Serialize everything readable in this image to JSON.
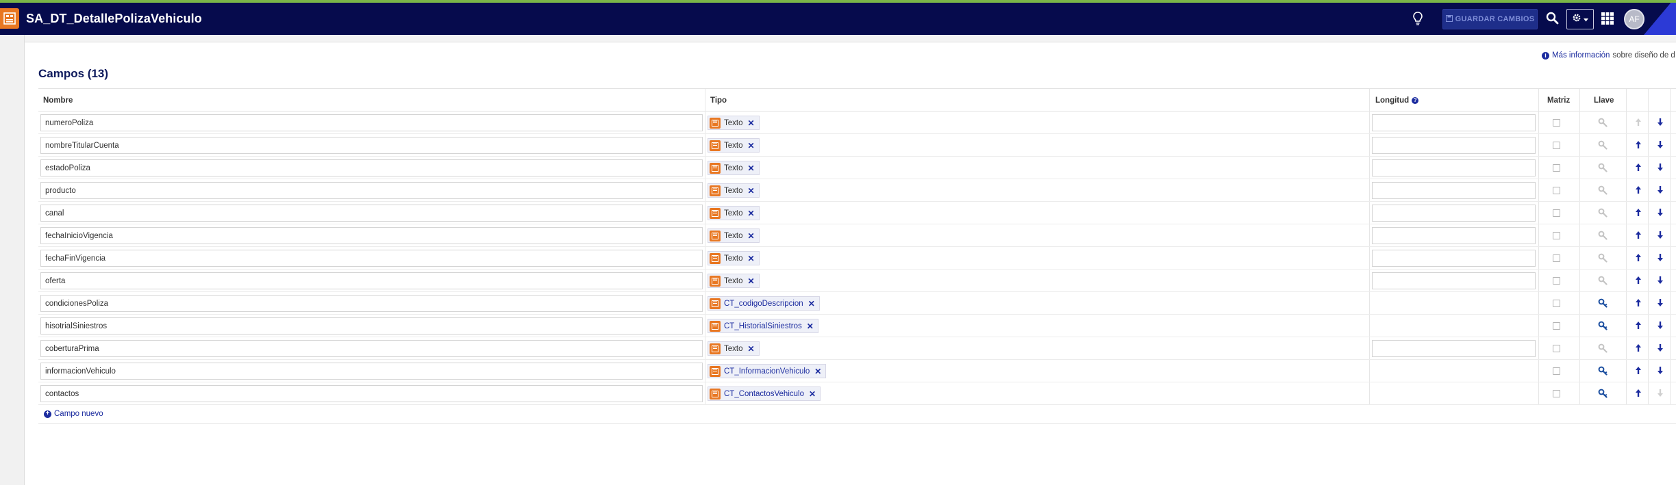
{
  "header": {
    "title": "SA_DT_DetallePolizaVehiculo",
    "save_label": "GUARDAR CAMBIOS",
    "avatar_initials": "AF",
    "icons": {
      "app": "data-type-icon",
      "bulb": "lightbulb-icon",
      "save": "save-icon",
      "search": "search-icon",
      "gear": "gear-icon",
      "apps": "grid-icon"
    },
    "colors": {
      "bar": "#060b4d",
      "accent": "#e87722",
      "top_line": "#7ab648"
    }
  },
  "info": {
    "link_text": "Más información",
    "rest_text": "sobre diseño de d"
  },
  "section": {
    "title": "Campos (13)"
  },
  "table": {
    "columns": {
      "name": "Nombre",
      "type": "Tipo",
      "length": "Longitud",
      "array": "Matriz",
      "key": "Llave"
    },
    "rows": [
      {
        "name": "numeroPoliza",
        "type": "Texto",
        "type_link": false,
        "has_length": true,
        "key_enabled": false,
        "up_enabled": false,
        "down_enabled": true
      },
      {
        "name": "nombreTitularCuenta",
        "type": "Texto",
        "type_link": false,
        "has_length": true,
        "key_enabled": false,
        "up_enabled": true,
        "down_enabled": true
      },
      {
        "name": "estadoPoliza",
        "type": "Texto",
        "type_link": false,
        "has_length": true,
        "key_enabled": false,
        "up_enabled": true,
        "down_enabled": true
      },
      {
        "name": "producto",
        "type": "Texto",
        "type_link": false,
        "has_length": true,
        "key_enabled": false,
        "up_enabled": true,
        "down_enabled": true
      },
      {
        "name": "canal",
        "type": "Texto",
        "type_link": false,
        "has_length": true,
        "key_enabled": false,
        "up_enabled": true,
        "down_enabled": true
      },
      {
        "name": "fechaInicioVigencia",
        "type": "Texto",
        "type_link": false,
        "has_length": true,
        "key_enabled": false,
        "up_enabled": true,
        "down_enabled": true
      },
      {
        "name": "fechaFinVigencia",
        "type": "Texto",
        "type_link": false,
        "has_length": true,
        "key_enabled": false,
        "up_enabled": true,
        "down_enabled": true
      },
      {
        "name": "oferta",
        "type": "Texto",
        "type_link": false,
        "has_length": true,
        "key_enabled": false,
        "up_enabled": true,
        "down_enabled": true
      },
      {
        "name": "condicionesPoliza",
        "type": "CT_codigoDescripcion",
        "type_link": true,
        "has_length": false,
        "key_enabled": true,
        "up_enabled": true,
        "down_enabled": true
      },
      {
        "name": "hisotrialSiniestros",
        "type": "CT_HistorialSiniestros",
        "type_link": true,
        "has_length": false,
        "key_enabled": true,
        "up_enabled": true,
        "down_enabled": true
      },
      {
        "name": "coberturaPrima",
        "type": "Texto",
        "type_link": false,
        "has_length": true,
        "key_enabled": false,
        "up_enabled": true,
        "down_enabled": true
      },
      {
        "name": "informacionVehiculo",
        "type": "CT_InformacionVehiculo",
        "type_link": true,
        "has_length": false,
        "key_enabled": true,
        "up_enabled": true,
        "down_enabled": true
      },
      {
        "name": "contactos",
        "type": "CT_ContactosVehiculo",
        "type_link": true,
        "has_length": false,
        "key_enabled": true,
        "up_enabled": true,
        "down_enabled": false
      }
    ]
  },
  "new_field_label": "Campo nuevo"
}
